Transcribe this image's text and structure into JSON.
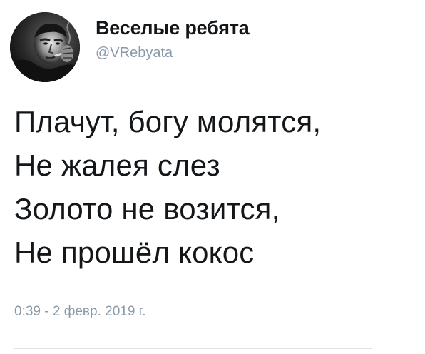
{
  "account": {
    "display_name": "Веселые ребята",
    "handle": "@VRebyata",
    "avatar_icon": "bw-portrait-avatar"
  },
  "tweet": {
    "lines": [
      "Плачут, богу молятся,",
      "Не жалея слез",
      "Золото не возится,",
      "Не прошёл кокос"
    ],
    "timestamp": "0:39 - 2 февр. 2019 г."
  },
  "colors": {
    "text": "#14171a",
    "secondary_text": "#8a9aa8",
    "divider": "#dfe3e6"
  }
}
